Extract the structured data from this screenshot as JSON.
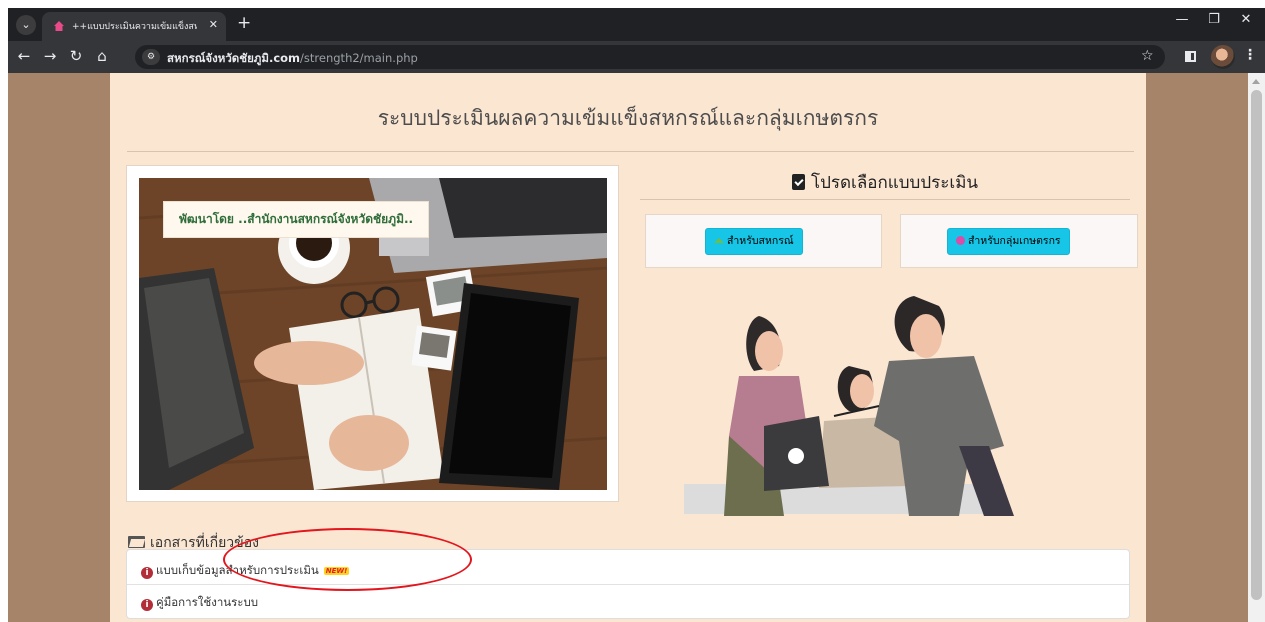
{
  "browser": {
    "tab_title": "++แบบประเมินความเข้มแข็งสหกรณ์",
    "url_domain": "สหกรณ์จังหวัดชัยภูมิ.com",
    "url_path": "/strength2/main.php"
  },
  "page": {
    "title": "ระบบประเมินผลความเข้มแข็งสหกรณ์และกลุ่มเกษตรกร",
    "credit": "พัฒนาโดย ..สำนักงานสหกรณ์จังหวัดชัยภูมิ..",
    "select_heading": "โปรดเลือกแบบประเมิน",
    "buttons": {
      "cooperative": "สำหรับสหกรณ์",
      "farmer_group": "สำหรับกลุ่มเกษตรกร"
    },
    "docs": {
      "heading": "เอกสารที่เกี่ยวข้อง",
      "items": [
        {
          "label": "แบบเก็บข้อมูลสำหรับการประเมิน",
          "badge": "NEW!"
        },
        {
          "label": "คู่มือการใช้งานระบบ"
        }
      ]
    }
  },
  "colors": {
    "page_bg": "#a58469",
    "container_bg": "#fbe6d2",
    "button": "#17c5e6",
    "credit_text": "#2f6d3a",
    "highlight": "#e3151d"
  }
}
